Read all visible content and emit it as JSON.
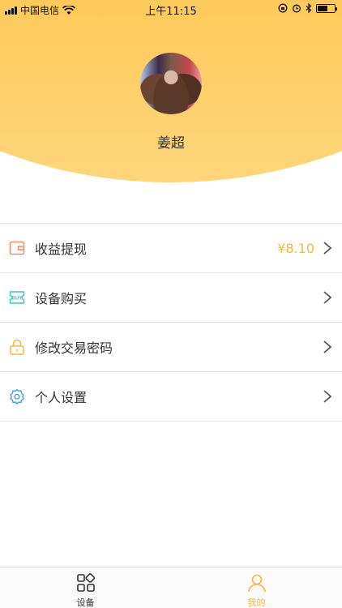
{
  "status_bar": {
    "carrier": "中国电信",
    "time": "上午11:15"
  },
  "profile": {
    "name": "姜超"
  },
  "menu": [
    {
      "label": "收益提现",
      "value": "¥8.10",
      "icon": "wallet-icon",
      "icon_color": "#f08a6a"
    },
    {
      "label": "设备购买",
      "value": "",
      "icon": "buy-ticket-icon",
      "icon_color": "#3cc6c0"
    },
    {
      "label": "修改交易密码",
      "value": "",
      "icon": "lock-icon",
      "icon_color": "#f5b93a"
    },
    {
      "label": "个人设置",
      "value": "",
      "icon": "gear-icon",
      "icon_color": "#3a9ad9"
    }
  ],
  "tabbar": {
    "tabs": [
      {
        "label": "设备",
        "icon": "grid-icon",
        "active": false
      },
      {
        "label": "我的",
        "icon": "person-icon",
        "active": true
      }
    ],
    "active_color": "#f5b93a",
    "inactive_color": "#333333"
  },
  "colors": {
    "header_gradient_top": "#fdb535",
    "header_gradient_bottom": "#fed67a",
    "value_color": "#f5b93a"
  }
}
